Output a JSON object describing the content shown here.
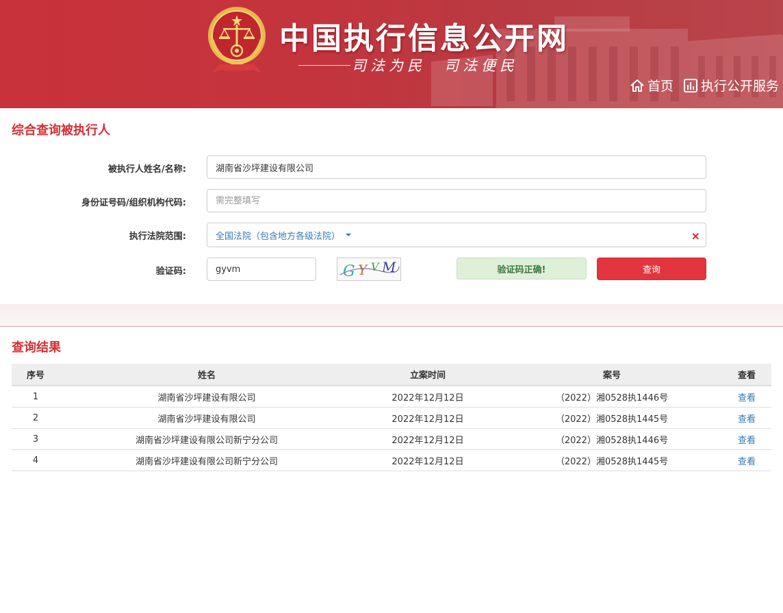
{
  "header": {
    "site_title": "中国执行信息公开网",
    "slogan": "司法为民　司法便民",
    "nav": {
      "home": "首页",
      "service": "执行公开服务"
    }
  },
  "search": {
    "title": "综合查询被执行人",
    "name_label": "被执行人姓名/名称:",
    "name_value": "湖南省沙坪建设有限公司",
    "id_label": "身份证号码/组织机构代码:",
    "id_placeholder": "需完整填写",
    "court_label": "执行法院范围:",
    "court_value": "全国法院（包含地方各级法院）",
    "captcha_label": "验证码:",
    "captcha_value": "gyvm",
    "captcha_image_text": "GYVM",
    "captcha_status": "验证码正确!",
    "submit_label": "查询",
    "clear_icon": "×"
  },
  "results": {
    "title": "查询结果",
    "columns": [
      "序号",
      "姓名",
      "立案时间",
      "案号",
      "查看"
    ],
    "rows": [
      [
        "1",
        "湖南省沙坪建设有限公司",
        "2022年12月12日",
        "（2022）湘0528执1446号",
        "查看"
      ],
      [
        "2",
        "湖南省沙坪建设有限公司",
        "2022年12月12日",
        "（2022）湘0528执1445号",
        "查看"
      ],
      [
        "3",
        "湖南省沙坪建设有限公司新宁分公司",
        "2022年12月12日",
        "（2022）湘0528执1446号",
        "查看"
      ],
      [
        "4",
        "湖南省沙坪建设有限公司新宁分公司",
        "2022年12月12日",
        "（2022）湘0528执1445号",
        "查看"
      ]
    ]
  },
  "icons": {
    "emblem": "court-emblem-icon",
    "home": "home-icon",
    "service": "bar-chart-icon",
    "clear": "close-icon",
    "dropdown": "caret-down-icon"
  },
  "colors": {
    "brand_red": "#c8323a",
    "section_title": "#d52e33",
    "button_red": "#e2353e",
    "link_blue": "#337ab7",
    "success_bg": "#dff0d8",
    "success_text": "#3c763d"
  }
}
